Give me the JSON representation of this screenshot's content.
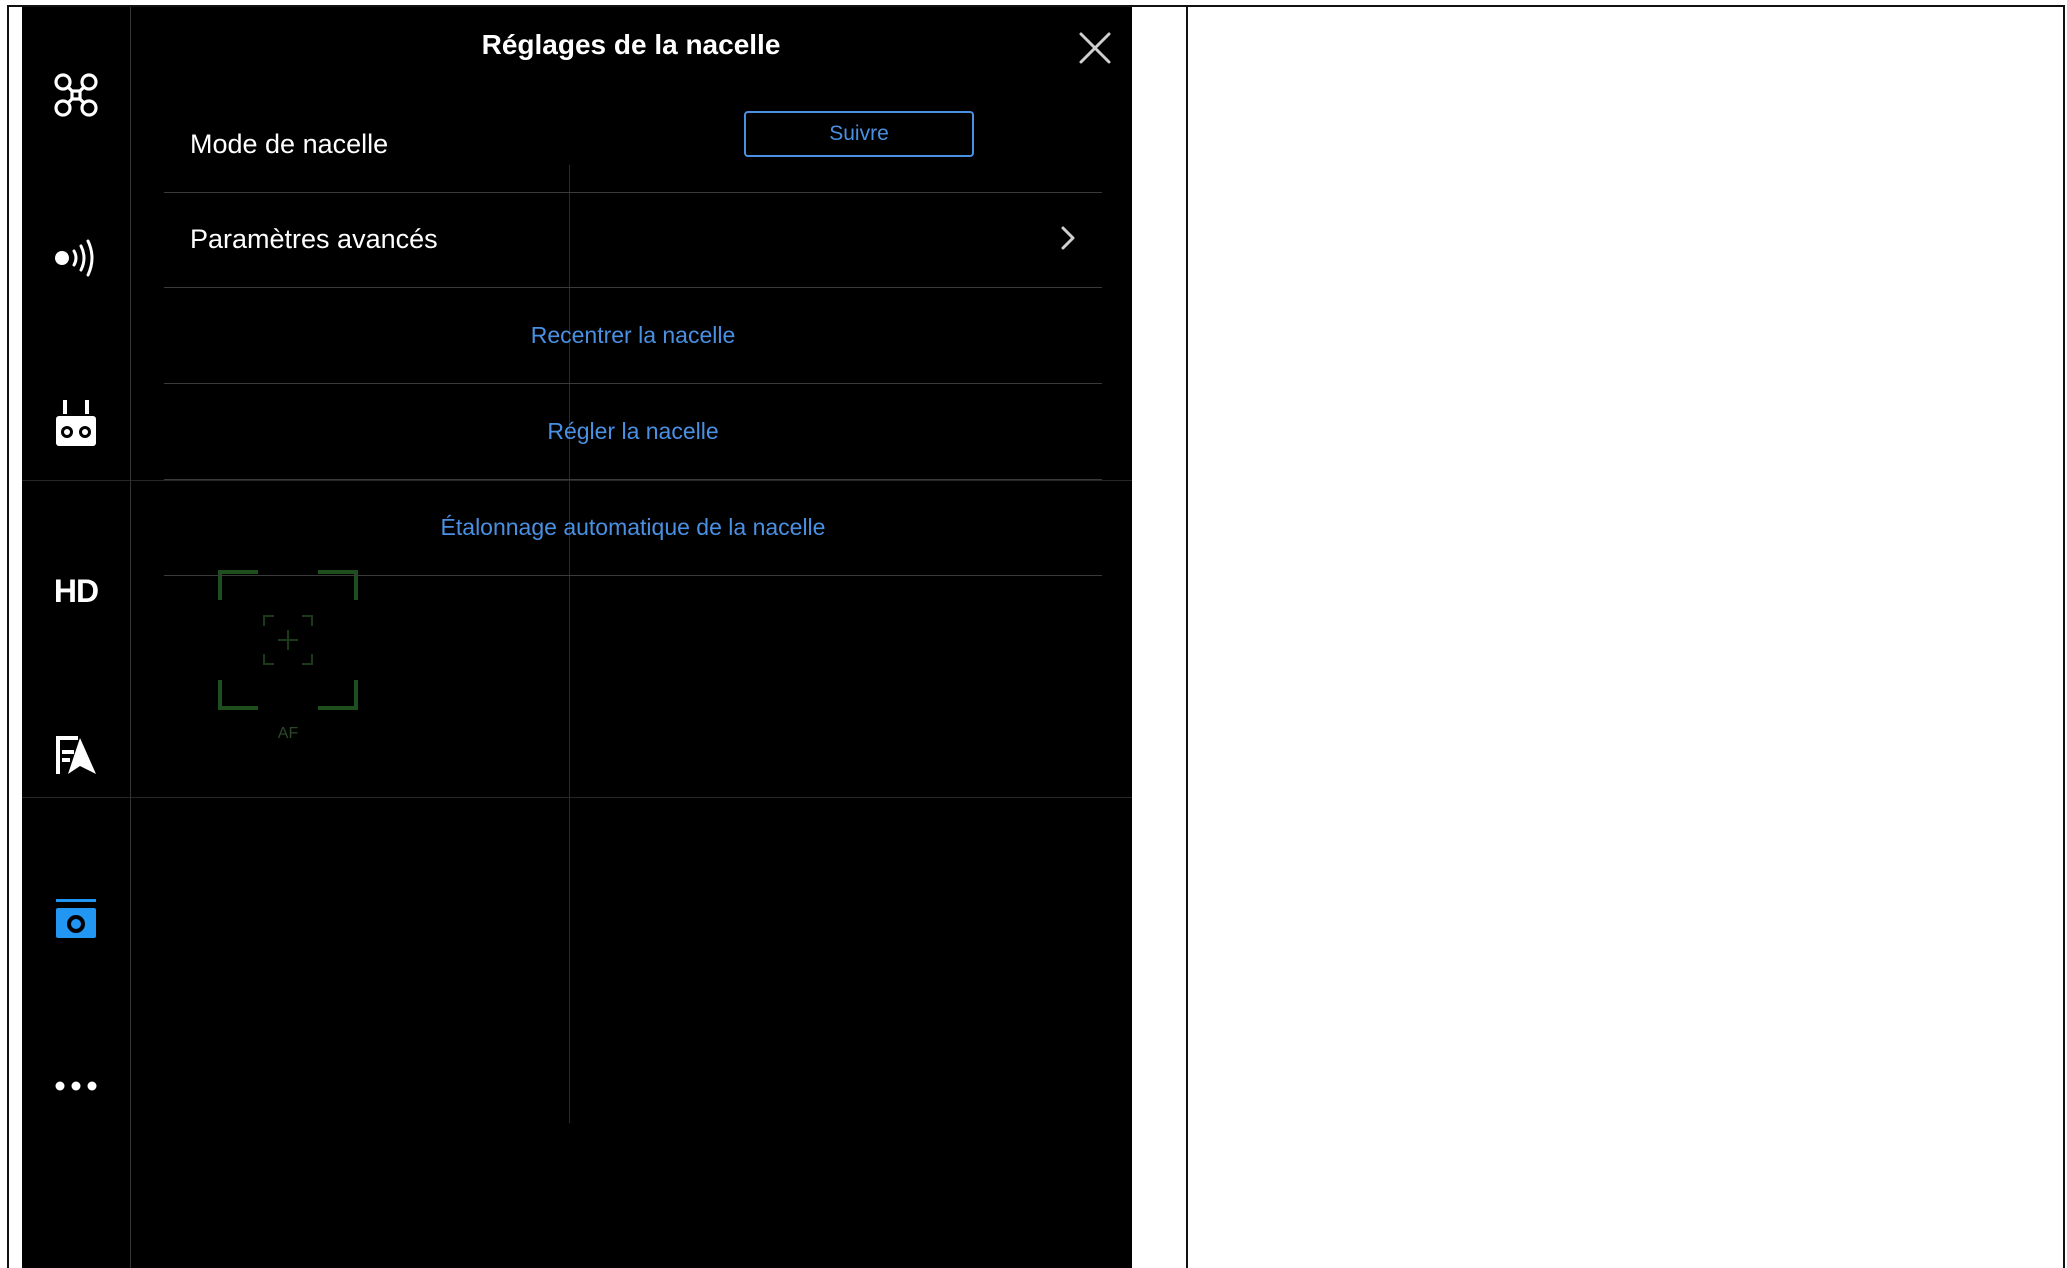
{
  "settings": {
    "title": "Réglages de la nacelle",
    "gimbal_mode": {
      "label": "Mode de nacelle",
      "value": "Suivre"
    },
    "advanced": {
      "label": "Paramètres avancés"
    },
    "actions": {
      "recenter": "Recentrer la nacelle",
      "adjust": "Régler la nacelle",
      "auto_calibrate": "Étalonnage automatique de la nacelle"
    }
  },
  "sidebar": {
    "items": [
      {
        "icon": "drone-icon"
      },
      {
        "icon": "signal-icon"
      },
      {
        "icon": "remote-controller-icon"
      },
      {
        "icon": "hd-icon",
        "label": "HD"
      },
      {
        "icon": "map-icon"
      },
      {
        "icon": "camera-icon",
        "active": true
      },
      {
        "icon": "more-icon"
      }
    ]
  },
  "camera_view": {
    "focus_label": "AF"
  },
  "colors": {
    "accent": "#4a90e2",
    "background": "#000000",
    "text": "#ffffff",
    "focus_box": "#1e4d1e"
  }
}
